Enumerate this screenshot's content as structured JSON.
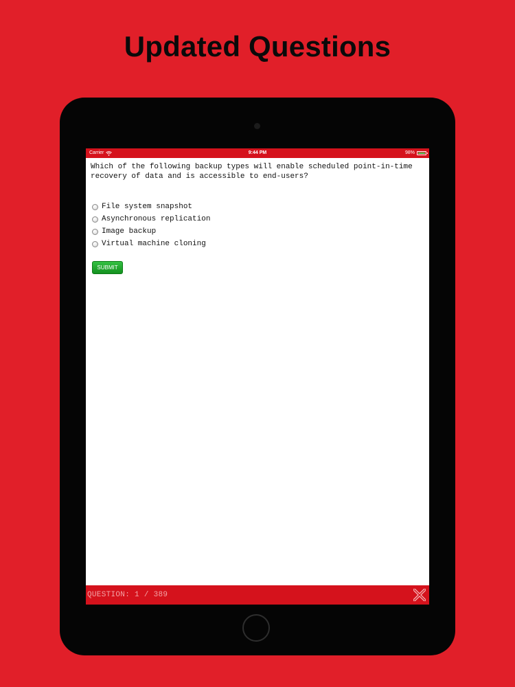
{
  "promo": {
    "headline": "Updated Questions"
  },
  "status_bar": {
    "carrier": "Carrier",
    "time": "9:44 PM",
    "battery": "98%",
    "battery_level": 0.98
  },
  "quiz": {
    "question": "Which of the following backup types will enable scheduled point-in-time recovery of data and is accessible to end-users?",
    "options": [
      "File system snapshot",
      "Asynchronous replication",
      "Image backup",
      "Virtual machine cloning"
    ],
    "submit_label": "SUBMIT"
  },
  "footer": {
    "counter": "QUESTION: 1 / 389",
    "close_icon": "close-x-icon"
  },
  "colors": {
    "background": "#e11f29",
    "app_bar": "#d5121c",
    "submit": "#1fa62c",
    "counter_text": "#f3a3a6"
  },
  "icons": {
    "wifi": "wifi-icon",
    "battery": "battery-icon",
    "radio": "radio-button-icon",
    "close": "close-x-icon"
  }
}
